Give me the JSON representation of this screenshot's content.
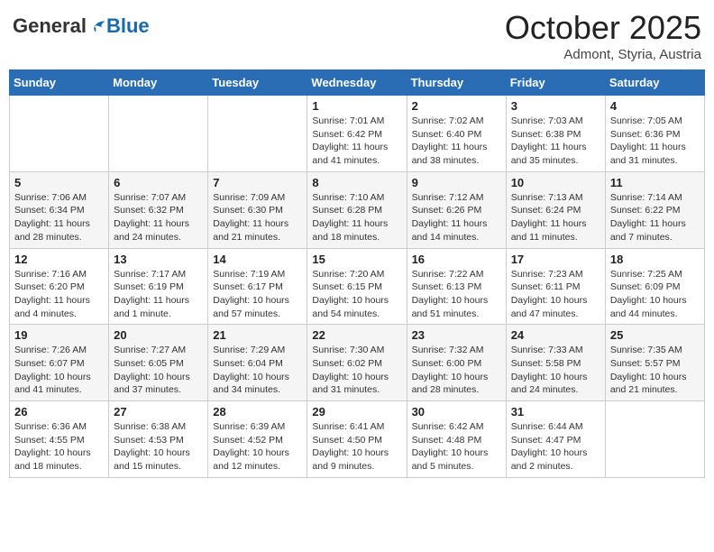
{
  "header": {
    "logo_general": "General",
    "logo_blue": "Blue",
    "month": "October 2025",
    "location": "Admont, Styria, Austria"
  },
  "weekdays": [
    "Sunday",
    "Monday",
    "Tuesday",
    "Wednesday",
    "Thursday",
    "Friday",
    "Saturday"
  ],
  "weeks": [
    [
      {
        "day": "",
        "info": ""
      },
      {
        "day": "",
        "info": ""
      },
      {
        "day": "",
        "info": ""
      },
      {
        "day": "1",
        "info": "Sunrise: 7:01 AM\nSunset: 6:42 PM\nDaylight: 11 hours and 41 minutes."
      },
      {
        "day": "2",
        "info": "Sunrise: 7:02 AM\nSunset: 6:40 PM\nDaylight: 11 hours and 38 minutes."
      },
      {
        "day": "3",
        "info": "Sunrise: 7:03 AM\nSunset: 6:38 PM\nDaylight: 11 hours and 35 minutes."
      },
      {
        "day": "4",
        "info": "Sunrise: 7:05 AM\nSunset: 6:36 PM\nDaylight: 11 hours and 31 minutes."
      }
    ],
    [
      {
        "day": "5",
        "info": "Sunrise: 7:06 AM\nSunset: 6:34 PM\nDaylight: 11 hours and 28 minutes."
      },
      {
        "day": "6",
        "info": "Sunrise: 7:07 AM\nSunset: 6:32 PM\nDaylight: 11 hours and 24 minutes."
      },
      {
        "day": "7",
        "info": "Sunrise: 7:09 AM\nSunset: 6:30 PM\nDaylight: 11 hours and 21 minutes."
      },
      {
        "day": "8",
        "info": "Sunrise: 7:10 AM\nSunset: 6:28 PM\nDaylight: 11 hours and 18 minutes."
      },
      {
        "day": "9",
        "info": "Sunrise: 7:12 AM\nSunset: 6:26 PM\nDaylight: 11 hours and 14 minutes."
      },
      {
        "day": "10",
        "info": "Sunrise: 7:13 AM\nSunset: 6:24 PM\nDaylight: 11 hours and 11 minutes."
      },
      {
        "day": "11",
        "info": "Sunrise: 7:14 AM\nSunset: 6:22 PM\nDaylight: 11 hours and 7 minutes."
      }
    ],
    [
      {
        "day": "12",
        "info": "Sunrise: 7:16 AM\nSunset: 6:20 PM\nDaylight: 11 hours and 4 minutes."
      },
      {
        "day": "13",
        "info": "Sunrise: 7:17 AM\nSunset: 6:19 PM\nDaylight: 11 hours and 1 minute."
      },
      {
        "day": "14",
        "info": "Sunrise: 7:19 AM\nSunset: 6:17 PM\nDaylight: 10 hours and 57 minutes."
      },
      {
        "day": "15",
        "info": "Sunrise: 7:20 AM\nSunset: 6:15 PM\nDaylight: 10 hours and 54 minutes."
      },
      {
        "day": "16",
        "info": "Sunrise: 7:22 AM\nSunset: 6:13 PM\nDaylight: 10 hours and 51 minutes."
      },
      {
        "day": "17",
        "info": "Sunrise: 7:23 AM\nSunset: 6:11 PM\nDaylight: 10 hours and 47 minutes."
      },
      {
        "day": "18",
        "info": "Sunrise: 7:25 AM\nSunset: 6:09 PM\nDaylight: 10 hours and 44 minutes."
      }
    ],
    [
      {
        "day": "19",
        "info": "Sunrise: 7:26 AM\nSunset: 6:07 PM\nDaylight: 10 hours and 41 minutes."
      },
      {
        "day": "20",
        "info": "Sunrise: 7:27 AM\nSunset: 6:05 PM\nDaylight: 10 hours and 37 minutes."
      },
      {
        "day": "21",
        "info": "Sunrise: 7:29 AM\nSunset: 6:04 PM\nDaylight: 10 hours and 34 minutes."
      },
      {
        "day": "22",
        "info": "Sunrise: 7:30 AM\nSunset: 6:02 PM\nDaylight: 10 hours and 31 minutes."
      },
      {
        "day": "23",
        "info": "Sunrise: 7:32 AM\nSunset: 6:00 PM\nDaylight: 10 hours and 28 minutes."
      },
      {
        "day": "24",
        "info": "Sunrise: 7:33 AM\nSunset: 5:58 PM\nDaylight: 10 hours and 24 minutes."
      },
      {
        "day": "25",
        "info": "Sunrise: 7:35 AM\nSunset: 5:57 PM\nDaylight: 10 hours and 21 minutes."
      }
    ],
    [
      {
        "day": "26",
        "info": "Sunrise: 6:36 AM\nSunset: 4:55 PM\nDaylight: 10 hours and 18 minutes."
      },
      {
        "day": "27",
        "info": "Sunrise: 6:38 AM\nSunset: 4:53 PM\nDaylight: 10 hours and 15 minutes."
      },
      {
        "day": "28",
        "info": "Sunrise: 6:39 AM\nSunset: 4:52 PM\nDaylight: 10 hours and 12 minutes."
      },
      {
        "day": "29",
        "info": "Sunrise: 6:41 AM\nSunset: 4:50 PM\nDaylight: 10 hours and 9 minutes."
      },
      {
        "day": "30",
        "info": "Sunrise: 6:42 AM\nSunset: 4:48 PM\nDaylight: 10 hours and 5 minutes."
      },
      {
        "day": "31",
        "info": "Sunrise: 6:44 AM\nSunset: 4:47 PM\nDaylight: 10 hours and 2 minutes."
      },
      {
        "day": "",
        "info": ""
      }
    ]
  ]
}
